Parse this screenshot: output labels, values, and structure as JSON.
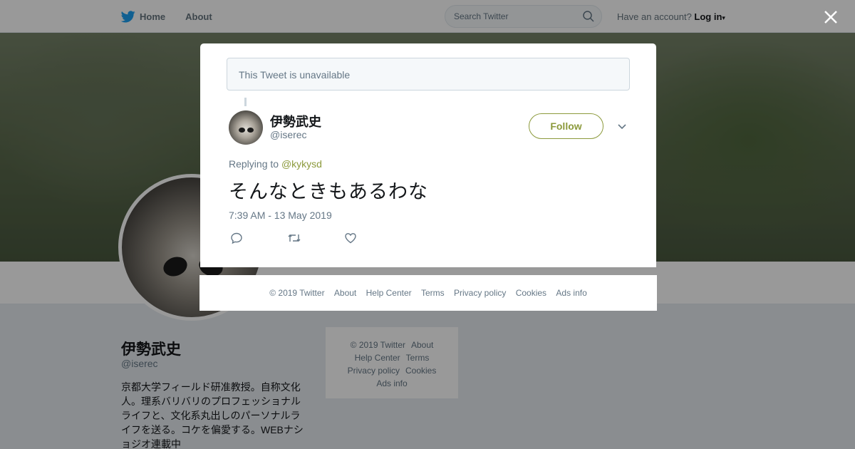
{
  "nav": {
    "home_label": "Home",
    "about_label": "About"
  },
  "search": {
    "placeholder": "Search Twitter"
  },
  "account": {
    "prompt": "Have an account?",
    "login_label": "Log in"
  },
  "profile": {
    "name": "伊勢武史",
    "handle": "@iserec",
    "bio": "京都大学フィールド研准教授。自称文化人。理系バリバリのプロフェッショナルライフと、文化系丸出しのパーソナルライフを送る。コケを偏愛する。WEBナショジオ連載中"
  },
  "side_footer": {
    "items": [
      "© 2019 Twitter",
      "About",
      "Help Center",
      "Terms",
      "Privacy policy",
      "Cookies",
      "Ads info"
    ]
  },
  "modal": {
    "unavailable_text": "This Tweet is unavailable",
    "tweet": {
      "author_name": "伊勢武史",
      "author_handle": "@iserec",
      "follow_label": "Follow",
      "replying_prefix": "Replying to",
      "replying_mention": "@kykysd",
      "text": "そんなときもあるわな",
      "timestamp": "7:39 AM - 13 May 2019"
    },
    "footer": {
      "items": [
        "© 2019 Twitter",
        "About",
        "Help Center",
        "Terms",
        "Privacy policy",
        "Cookies",
        "Ads info"
      ]
    }
  },
  "colors": {
    "accent": "#8c9a3c",
    "twitter_blue": "#1da1f2",
    "text_secondary": "#657786"
  },
  "icons": {
    "logo": "twitter-bird-icon",
    "close": "close-icon",
    "search": "search-icon",
    "caret": "chevron-down-icon",
    "reply": "reply-icon",
    "retweet": "retweet-icon",
    "like": "heart-icon"
  }
}
